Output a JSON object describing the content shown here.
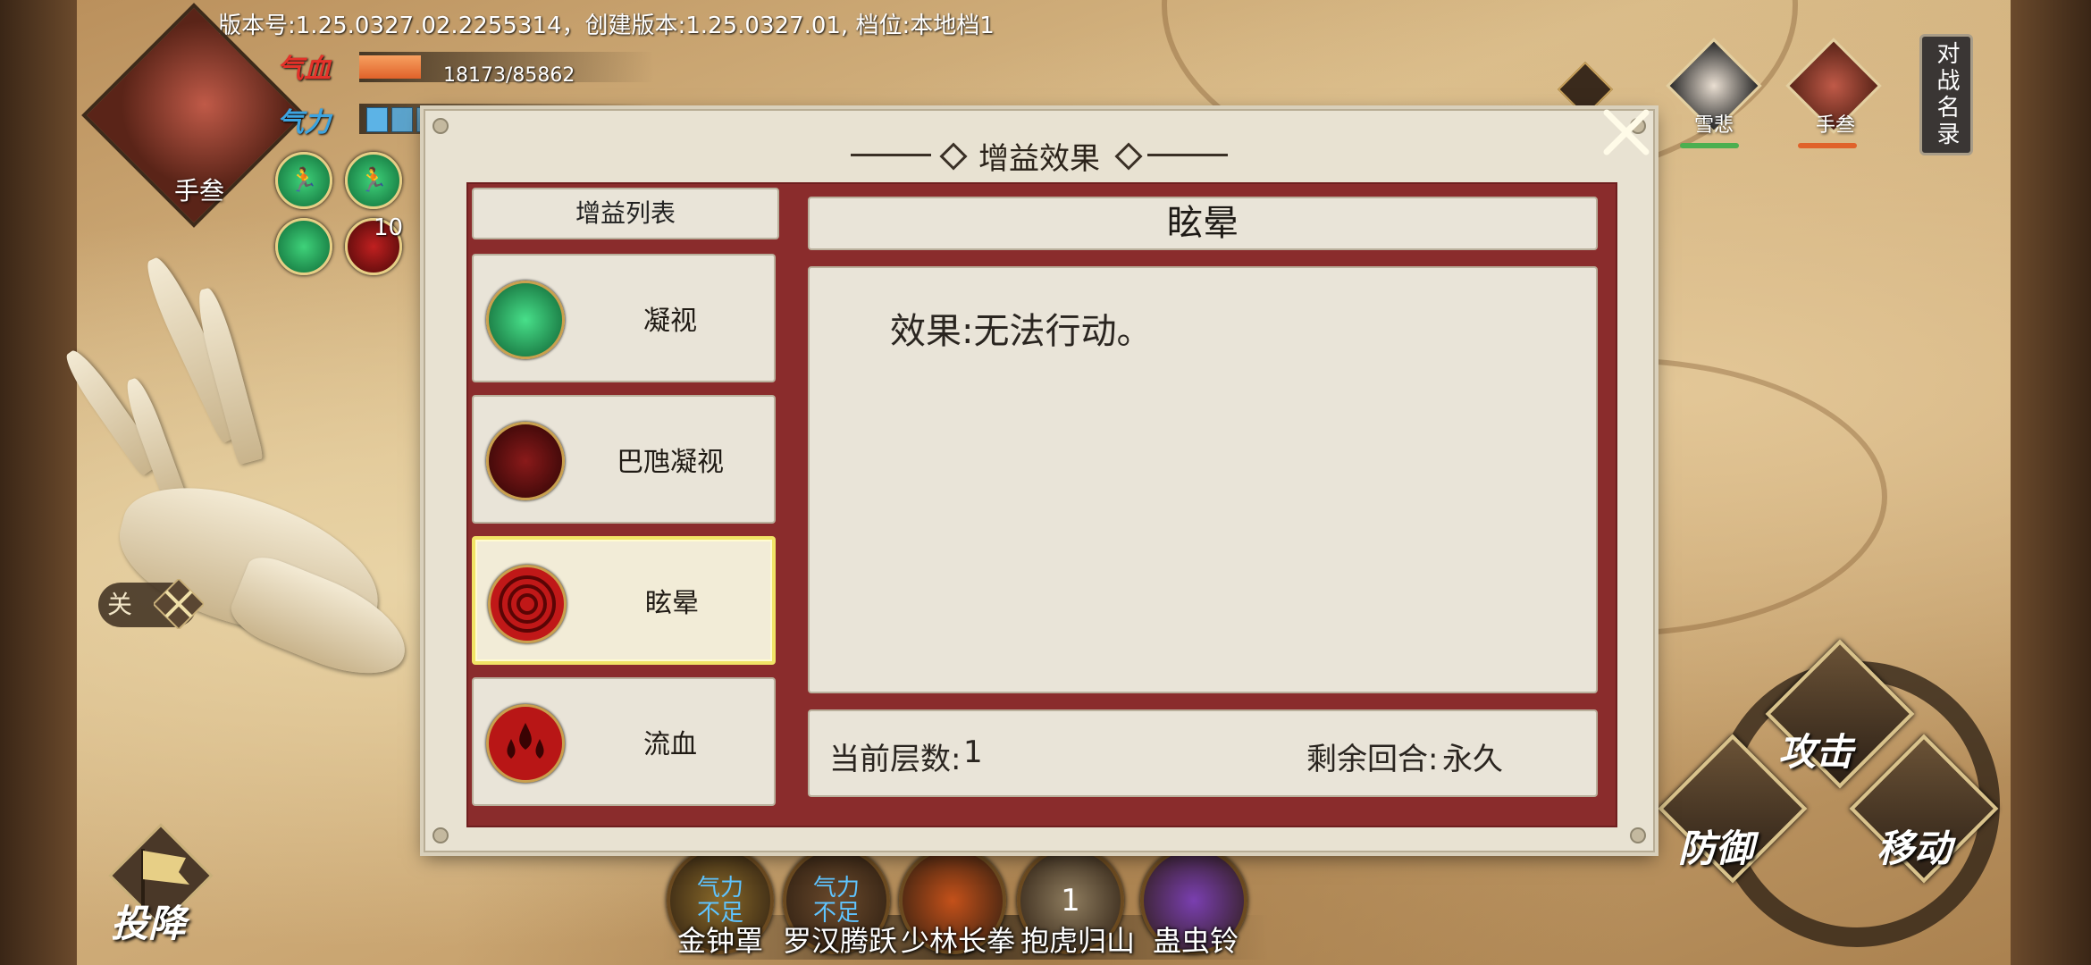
{
  "version_text": "版本号:1.25.0327.02.2255314，创建版本:1.25.0327.01, 档位:本地档1",
  "player": {
    "name": "手叁",
    "hp_label": "气血",
    "hp_text": "18173/85862",
    "hp_fraction": 0.21,
    "mp_label": "气力",
    "mp_segments": 6,
    "buff_count": "10"
  },
  "roster": {
    "title": "对战名录",
    "members": [
      {
        "name": "雪悲",
        "bar_color": "#4caf50"
      },
      {
        "name": "手叁",
        "bar_color": "#e0622a"
      }
    ]
  },
  "toggle": {
    "label": "关"
  },
  "surrender_label": "投降",
  "actions": {
    "attack": "攻击",
    "defend": "防御",
    "move": "移动"
  },
  "skills": [
    {
      "name": "金钟罩",
      "status": "气力\n不足",
      "color": "#8a6a2a"
    },
    {
      "name": "罗汉腾跃",
      "status": "气力\n不足",
      "color": "#6b4a2c"
    },
    {
      "name": "少林长拳",
      "status": "",
      "color": "#c4511a"
    },
    {
      "name": "抱虎归山",
      "status": "1",
      "color": "#8e7c5e"
    },
    {
      "name": "蛊虫铃",
      "status": "",
      "color": "#7a3fb0"
    }
  ],
  "modal": {
    "title": "增益效果",
    "list_header": "增益列表",
    "items": [
      {
        "label": "凝视",
        "icon": "green-boot-icon",
        "color": "green"
      },
      {
        "label": "巴虺凝视",
        "icon": "red-seal-icon",
        "color": "darkred"
      },
      {
        "label": "眩晕",
        "icon": "red-spiral-icon",
        "color": "red",
        "selected": true
      },
      {
        "label": "流血",
        "icon": "blood-drops-icon",
        "color": "red"
      }
    ],
    "detail": {
      "title": "眩晕",
      "effect": "效果:无法行动。",
      "layers_label": "当前层数:",
      "layers_value": "1",
      "rounds_label": "剩余回合:",
      "rounds_value": "永久"
    }
  }
}
